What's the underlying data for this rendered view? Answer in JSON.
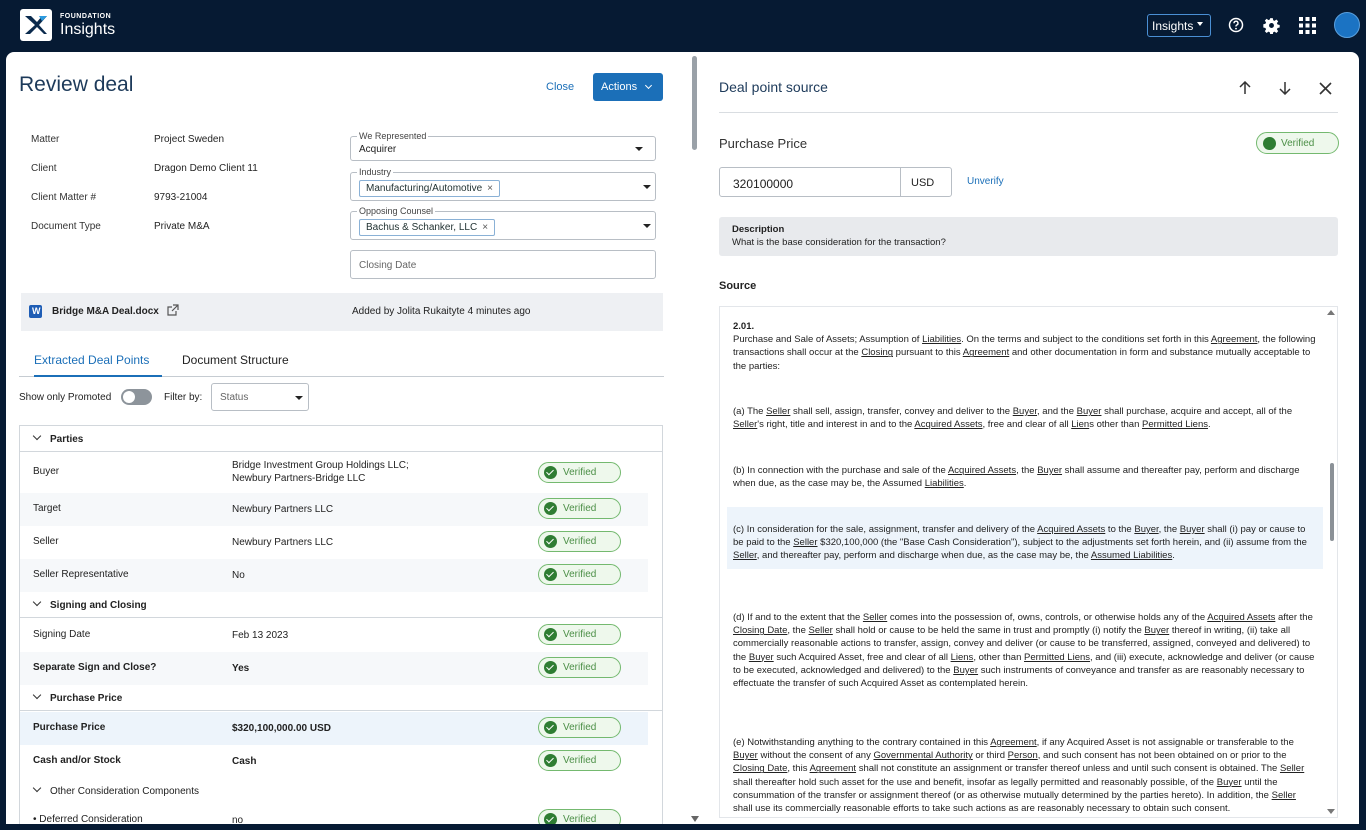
{
  "app": {
    "brand_small": "FOUNDATION",
    "brand_name": "Insights",
    "switcher_label": "Insights"
  },
  "left": {
    "title": "Review deal",
    "close_label": "Close",
    "actions_label": "Actions",
    "meta": [
      {
        "label": "Matter",
        "value": "Project Sweden"
      },
      {
        "label": "Client",
        "value": "Dragon Demo Client 11"
      },
      {
        "label": "Client Matter #",
        "value": "9793-21004"
      },
      {
        "label": "Document Type",
        "value": "Private M&A"
      }
    ],
    "we_represented": {
      "label": "We Represented",
      "value": "Acquirer"
    },
    "industry": {
      "label": "Industry",
      "chip": "Manufacturing/Automotive"
    },
    "opposing": {
      "label": "Opposing Counsel",
      "chip": "Bachus & Schanker, LLC"
    },
    "closing_date": {
      "placeholder": "Closing Date"
    },
    "document": {
      "name": "Bridge M&A Deal.docx",
      "added": "Added by Jolita Rukaityte 4 minutes ago"
    },
    "tabs": [
      "Extracted Deal Points",
      "Document Structure"
    ],
    "filters": {
      "show_promoted": "Show only Promoted",
      "filter_by": "Filter by:",
      "status_placeholder": "Status"
    },
    "sections": [
      {
        "name": "Parties"
      },
      {
        "name": "Signing and Closing"
      },
      {
        "name": "Purchase Price"
      },
      {
        "name": "Other Consideration Components"
      }
    ],
    "rows": [
      {
        "key": "Buyer",
        "value_line1": "Bridge Investment Group Holdings LLC;",
        "value_line2": "Newbury Partners-Bridge LLC",
        "status": "Verified"
      },
      {
        "key": "Target",
        "value": "Newbury Partners LLC",
        "status": "Verified"
      },
      {
        "key": "Seller",
        "value": "Newbury Partners LLC",
        "status": "Verified"
      },
      {
        "key": "Seller Representative",
        "value": "No",
        "status": "Verified"
      },
      {
        "key": "Signing Date",
        "value": "Feb 13 2023",
        "status": "Verified"
      },
      {
        "key": "Separate Sign and Close?",
        "value": "Yes",
        "status": "Verified"
      },
      {
        "key": "Purchase Price",
        "value": "$320,100,000.00 USD",
        "status": "Verified"
      },
      {
        "key": "Cash and/or Stock",
        "value": "Cash",
        "status": "Verified"
      },
      {
        "key": "• Deferred Consideration",
        "value": "no",
        "status": "Verified"
      }
    ]
  },
  "right": {
    "title": "Deal point source",
    "field_title": "Purchase Price",
    "status": "Verified",
    "amount": "320100000",
    "currency": "USD",
    "unverify_label": "Unverify",
    "description_label": "Description",
    "description_text": "What is the base consideration for the transaction?",
    "source_label": "Source"
  }
}
